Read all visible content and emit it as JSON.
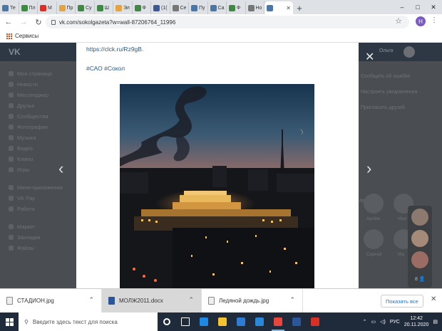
{
  "browser": {
    "tabs": [
      {
        "label": "Те",
        "color": "#4a76a8"
      },
      {
        "label": "Пл",
        "color": "#3d8b40"
      },
      {
        "label": "М",
        "color": "#d93025"
      },
      {
        "label": "Пр",
        "color": "#e8a33d"
      },
      {
        "label": "Су",
        "color": "#3d8b40"
      },
      {
        "label": "Ш",
        "color": "#3d8b40"
      },
      {
        "label": "Эл",
        "color": "#e8a33d"
      },
      {
        "label": "Ф",
        "color": "#3d8b40"
      },
      {
        "label": "(1(",
        "color": "#3b5998"
      },
      {
        "label": "Се",
        "color": "#777777"
      },
      {
        "label": "Пу",
        "color": "#4a76a8"
      },
      {
        "label": "Са",
        "color": "#4a76a8"
      },
      {
        "label": "Ф",
        "color": "#3d8b40"
      },
      {
        "label": "Но",
        "color": "#777777"
      }
    ],
    "active_tab_close": "✕",
    "new_tab": "+",
    "window_controls": {
      "minimize": "–",
      "maximize": "□",
      "close": "✕"
    },
    "url": "vk.com/sokolgazeta?w=wall-87206764_11996",
    "profile_initial": "Н",
    "bookmarks_label": "Сервисы"
  },
  "vk": {
    "logo": "VK",
    "user_name": "Ольга",
    "sidebar": [
      "Моя страница",
      "Новости",
      "Мессенджер",
      "Друзья",
      "Сообщества",
      "Фотографии",
      "Музыка",
      "Видео",
      "Клипы",
      "Игры"
    ],
    "sidebar_secondary": [
      "Мини-приложения",
      "VK Pay",
      "Работа"
    ],
    "sidebar_tertiary": [
      "Маркет",
      "Закладки",
      "Файлы"
    ],
    "right_col": [
      "Сообщить об ошибке",
      "Настроить уведомления",
      "Пригласить друзей"
    ],
    "friends_label": "друзья",
    "friend_names": [
      "Артём",
      "Ири",
      "Сергей",
      "Ма"
    ],
    "post": {
      "link": "https://clck.ru/Rz9gB.",
      "tags": "#САО #Сокол"
    },
    "chat_count": "8 👤"
  },
  "downloads": {
    "items": [
      {
        "name": "СТАДИОН.jpg",
        "type": "jpg"
      },
      {
        "name": "МОЛЖ2011.docx",
        "type": "docx"
      },
      {
        "name": "Ледяной дождь.jpg",
        "type": "jpg"
      }
    ],
    "show_all": "Показать все",
    "close": "✕"
  },
  "taskbar": {
    "search_placeholder": "Введите здесь текст для поиска",
    "lang": "РУС",
    "time": "12:42",
    "date": "20.11.2020",
    "apps": [
      {
        "name": "cortana",
        "color": "#1f2a3a"
      },
      {
        "name": "task-view",
        "color": "#1f2a3a"
      },
      {
        "name": "edge",
        "color": "#1e88e5"
      },
      {
        "name": "explorer",
        "color": "#f4c430"
      },
      {
        "name": "store",
        "color": "#2d7dd2"
      },
      {
        "name": "mail",
        "color": "#2b88d8"
      },
      {
        "name": "chrome",
        "color": "#e8453c"
      },
      {
        "name": "word",
        "color": "#2b579a"
      },
      {
        "name": "yandex",
        "color": "#d93025"
      }
    ]
  }
}
